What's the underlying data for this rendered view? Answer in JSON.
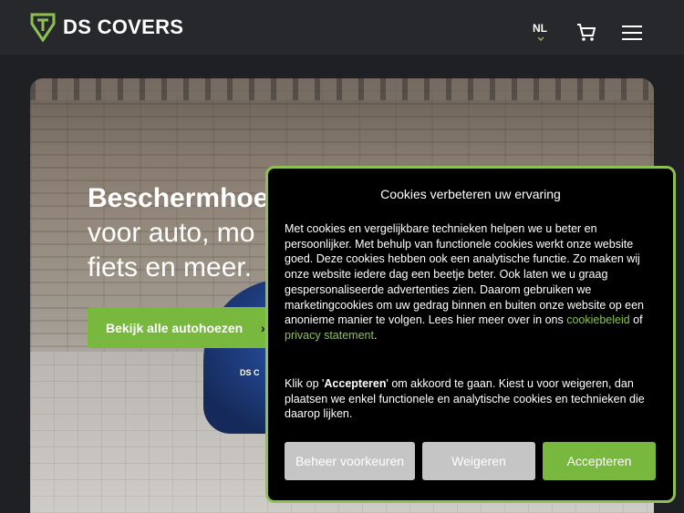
{
  "header": {
    "brand": "DS COVERS",
    "language": "NL",
    "icons": {
      "logo": "shield-logo-icon",
      "cart": "cart-icon",
      "menu": "hamburger-menu-icon",
      "lang_chevron": "chevron-down-icon"
    }
  },
  "hero": {
    "title_line1": "Beschermhoe",
    "title_line2": "voor auto, mo",
    "title_line3": "fiets en meer.",
    "cta_label": "Bekijk alle autohoezen",
    "cta_chevron": "›",
    "car_badge": "DS C"
  },
  "cookie": {
    "title": "Cookies verbeteren uw ervaring",
    "body_text": "Met cookies en vergelijkbare technieken helpen we u beter en persoonlijker. Met behulp van functionele cookies werkt onze website goed. Deze cookies hebben ook een analytische functie. Zo maken wij onze website iedere dag een beetje beter. Ook laten we u graag gespersonaliseerde advertenties zien. Daarom gebruiken we marketingcookies om uw gedrag binnen en buiten onze website op een anonieme manier te volgen. Lees hier meer over in ons ",
    "link_cookie_policy": "cookiebeleid",
    "link_connector": " of ",
    "link_privacy": "privacy statement",
    "body_end": ".",
    "body2_prefix": "Klik op '",
    "body2_bold": "Accepteren",
    "body2_suffix": "' om akkoord te gaan. Kiest u voor weigeren, dan plaatsen we enkel functionele en analytische cookies en technieken die daarop lijken.",
    "btn_manage": "Beheer voorkeuren",
    "btn_refuse": "Weigeren",
    "btn_accept": "Accepteren"
  },
  "colors": {
    "accent": "#78b83e",
    "header_bg": "#27282b",
    "page_bg": "#1f2023",
    "dialog_bg": "#000000",
    "button_grey": "#c5c5c5"
  }
}
